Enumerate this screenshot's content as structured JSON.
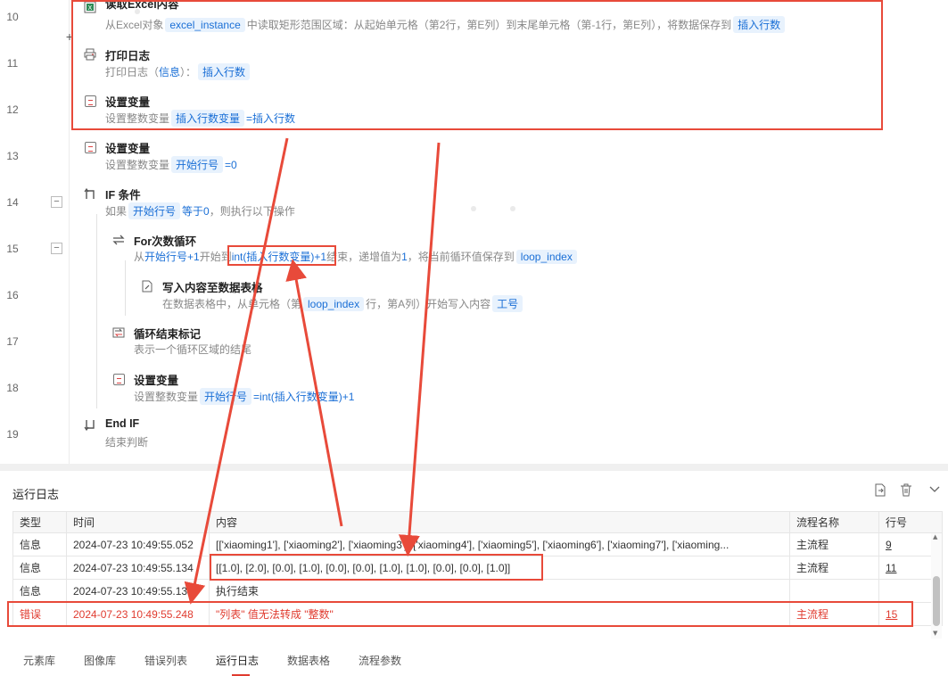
{
  "editor": {
    "row_numbers": [
      "10",
      "11",
      "12",
      "13",
      "14",
      "15",
      "16",
      "17",
      "18",
      "19"
    ],
    "steps": {
      "read_excel": {
        "title": "读取Excel内容",
        "desc_prefix": "从Excel对象",
        "tag1": "excel_instance",
        "desc_mid": "中读取矩形范围区域：从起始单元格（第2行，第E列）到末尾单元格（第-1行，第E列），将数据保存到",
        "tag2": "插入行数"
      },
      "print_log": {
        "title": "打印日志",
        "desc_prefix": "打印日志（",
        "level": "信息",
        "desc_mid": "）：",
        "tag": "插入行数"
      },
      "set_var_1": {
        "title": "设置变量",
        "desc_prefix": "设置整数变量",
        "tag": "插入行数变量",
        "desc_suffix": "=插入行数"
      },
      "set_var_2": {
        "title": "设置变量",
        "desc_prefix": "设置整数变量",
        "tag": "开始行号",
        "desc_suffix": "=0"
      },
      "if": {
        "title": "IF 条件",
        "desc_prefix": "如果",
        "tag": "开始行号",
        "desc_mid": "等于",
        "value": "0",
        "desc_suffix": "，则执行以下操作"
      },
      "for_loop": {
        "title": "For次数循环",
        "desc_prefix": "从",
        "start": "开始行号+1",
        "desc_mid1": "开始到",
        "end": "int(插入行数变量)+1",
        "desc_mid2": "结束，递增值为",
        "step": "1",
        "desc_mid3": "，将当前循环值保存到",
        "tag": "loop_index"
      },
      "write_table": {
        "title": "写入内容至数据表格",
        "desc_prefix": "在数据表格中，从单元格（第",
        "tag1": "loop_index",
        "desc_mid": "行，第A列）开始写入内容",
        "tag2": "工号"
      },
      "loop_end": {
        "title": "循环结束标记",
        "desc": "表示一个循环区域的结尾"
      },
      "set_var_3": {
        "title": "设置变量",
        "desc_prefix": "设置整数变量",
        "tag": "开始行号",
        "desc_suffix": "=int(插入行数变量)+1"
      },
      "end_if": {
        "title": "End IF",
        "desc": "结束判断"
      }
    }
  },
  "log": {
    "title": "运行日志",
    "columns": [
      "类型",
      "时间",
      "内容",
      "流程名称",
      "行号"
    ],
    "rows": [
      {
        "type": "信息",
        "time": "2024-07-23 10:49:55.052",
        "content": "[['xiaoming1'], ['xiaoming2'], ['xiaoming3'], ['xiaoming4'], ['xiaoming5'], ['xiaoming6'], ['xiaoming7'], ['xiaoming...",
        "flow": "主流程",
        "line": "9"
      },
      {
        "type": "信息",
        "time": "2024-07-23 10:49:55.134",
        "content": "[[1.0], [2.0], [0.0], [1.0], [0.0], [0.0], [1.0], [1.0], [0.0], [0.0], [1.0]]",
        "flow": "主流程",
        "line": "11"
      },
      {
        "type": "信息",
        "time": "2024-07-23 10:49:55.13",
        "content": "执行结束",
        "flow": "",
        "line": ""
      },
      {
        "type": "错误",
        "time": "2024-07-23 10:49:55.248",
        "content": "\"列表\" 值无法转成 \"整数\"",
        "flow": "主流程",
        "line": "15"
      }
    ]
  },
  "tabs": [
    "元素库",
    "图像库",
    "错误列表",
    "运行日志",
    "数据表格",
    "流程参数"
  ],
  "active_tab": "运行日志",
  "colors": {
    "accent_blue": "#1a6fd6",
    "tag_bg": "#e8f2fd",
    "annotation_red": "#e84a3a",
    "error_text": "#e03b2f"
  },
  "icons": {
    "export": "export-icon",
    "delete": "trash-icon",
    "collapse": "chevron-down-icon"
  }
}
